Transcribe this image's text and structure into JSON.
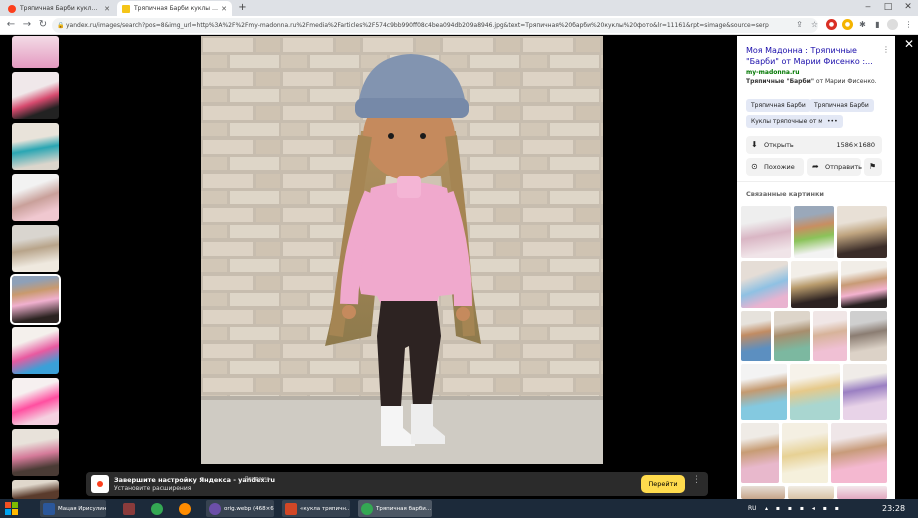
{
  "browser": {
    "tabs": [
      {
        "title": "Тряпичная Барби куклы фото -",
        "active": false
      },
      {
        "title": "Тряпичная Барби куклы фото :",
        "active": true
      }
    ],
    "new_tab": "+",
    "window_controls": [
      "‒",
      "□",
      "✕"
    ],
    "nav": {
      "back": "←",
      "forward": "→",
      "reload": "↻"
    },
    "url": "yandex.ru/images/search?pos=8&img_url=http%3A%2F%2Fmy-madonna.ru%2Fmedia%2Farticles%2F574c9bb990ff08c4bea094db209a8946.jpg&text=Тряпичная%20барби%20куклы%20фото&lr=11161&rpt=simage&source=serp"
  },
  "sidebar": {
    "title": "Моя Мадонна : Тряпичные \"Барби\" от Марии Фисенко :...",
    "domain": "my-madonna.ru",
    "description_bold": "Тряпичные \"Барби\"",
    "description_rest": " от Марии Фисенко.",
    "tags": [
      "Тряпичная Барби",
      "Тряпичная Барби",
      "Куклы тряпочные от м",
      "•••"
    ],
    "open_label": "Открыть",
    "size": "1586×1680",
    "similar_label": "Похожие",
    "share_label": "Отправить",
    "related_heading": "Связанные картинки",
    "more_glyph": "⋮",
    "close_glyph": "✕"
  },
  "notification": {
    "title": "Завершите настройку Яндекса - yandex.ru",
    "ad_label": "Реклама",
    "subtitle": "Установите расширения",
    "button": "Перейти",
    "menu": "⋮"
  },
  "taskbar": {
    "items": [
      {
        "label": "Мацая Ирисулин...",
        "color": "#2b579a"
      },
      {
        "label": "",
        "color": "#8a3b3b"
      },
      {
        "label": "",
        "color": "#34a853"
      },
      {
        "label": "",
        "color": "#ff8c00"
      },
      {
        "label": "orig.webp (468×6...",
        "color": "#6b4fa8"
      },
      {
        "label": "«кукла тряпичн...",
        "color": "#d24726"
      },
      {
        "label": "Тряпичная барби...",
        "color": "#34a853"
      }
    ],
    "lang": "RU",
    "clock": "23:28"
  },
  "colors": {
    "accent_link": "#1a0dab",
    "domain_green": "#007700",
    "ya_red": "#fc3f1d",
    "ya_yellow": "#ffdb4d"
  },
  "icons": {
    "download": "download-icon",
    "similar": "camera-search-icon",
    "share": "share-arrow-icon",
    "bookmark": "bookmark-icon"
  }
}
